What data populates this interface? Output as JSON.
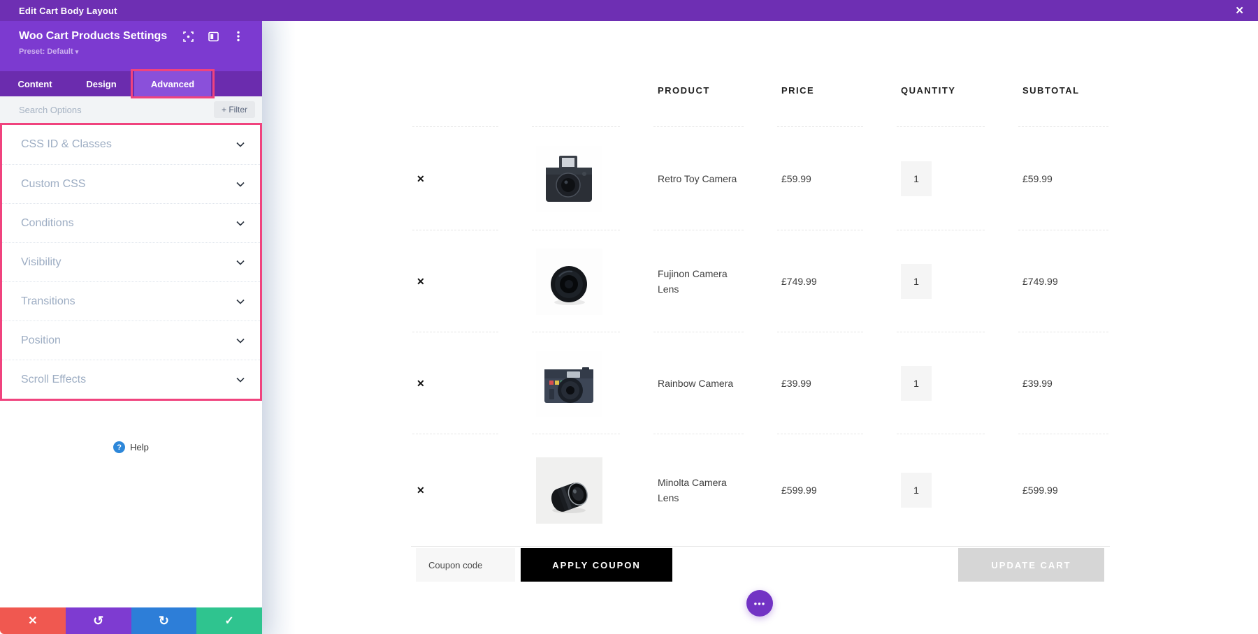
{
  "titlebar": {
    "title": "Edit Cart Body Layout",
    "close_icon": "✕"
  },
  "panel": {
    "title": "Woo Cart Products Settings",
    "preset": "Preset: Default",
    "preset_caret": "▾",
    "tabs": [
      {
        "label": "Content",
        "active": false
      },
      {
        "label": "Design",
        "active": false
      },
      {
        "label": "Advanced",
        "active": true
      }
    ],
    "search": {
      "placeholder": "Search Options"
    },
    "filter_button": "+ Filter",
    "accordion": {
      "items": [
        {
          "label": "CSS ID & Classes"
        },
        {
          "label": "Custom CSS"
        },
        {
          "label": "Conditions"
        },
        {
          "label": "Visibility"
        },
        {
          "label": "Transitions"
        },
        {
          "label": "Position"
        },
        {
          "label": "Scroll Effects"
        }
      ]
    },
    "help": {
      "icon": "?",
      "label": "Help"
    },
    "footer": {
      "cancel_icon": "✕",
      "undo_icon": "↺",
      "redo_icon": "↻",
      "save_icon": "✓"
    }
  },
  "cart": {
    "columns": {
      "product": "PRODUCT",
      "price": "PRICE",
      "quantity": "QUANTITY",
      "subtotal": "SUBTOTAL"
    },
    "remove_icon": "✕",
    "rows": [
      {
        "name": "Retro Toy Camera",
        "price": "£59.99",
        "qty": "1",
        "subtotal": "£59.99",
        "image": "retro-toy-camera"
      },
      {
        "name": "Fujinon Camera Lens",
        "price": "£749.99",
        "qty": "1",
        "subtotal": "£749.99",
        "image": "fujinon-camera-lens"
      },
      {
        "name": "Rainbow Camera",
        "price": "£39.99",
        "qty": "1",
        "subtotal": "£39.99",
        "image": "rainbow-camera"
      },
      {
        "name": "Minolta Camera Lens",
        "price": "£599.99",
        "qty": "1",
        "subtotal": "£599.99",
        "image": "minolta-camera-lens"
      }
    ],
    "coupon": {
      "placeholder": "Coupon code",
      "apply_label": "APPLY COUPON",
      "update_label": "UPDATE CART"
    },
    "more_options_icon": "•••"
  },
  "colors": {
    "topbar": "#6e2fb3",
    "panel_header": "#7c3ad0",
    "tabbar": "#6b2cae",
    "active_tab": "#8a50da",
    "annotation_pink": "#f0437e",
    "cancel_red": "#f05850",
    "undo_purple": "#7e3bd1",
    "redo_blue": "#2d7ed8",
    "save_green": "#2fc48f",
    "help_blue": "#2d87d9",
    "more_circle": "#7233c4",
    "apply_black": "#000000",
    "update_gray": "#d6d6d6"
  }
}
